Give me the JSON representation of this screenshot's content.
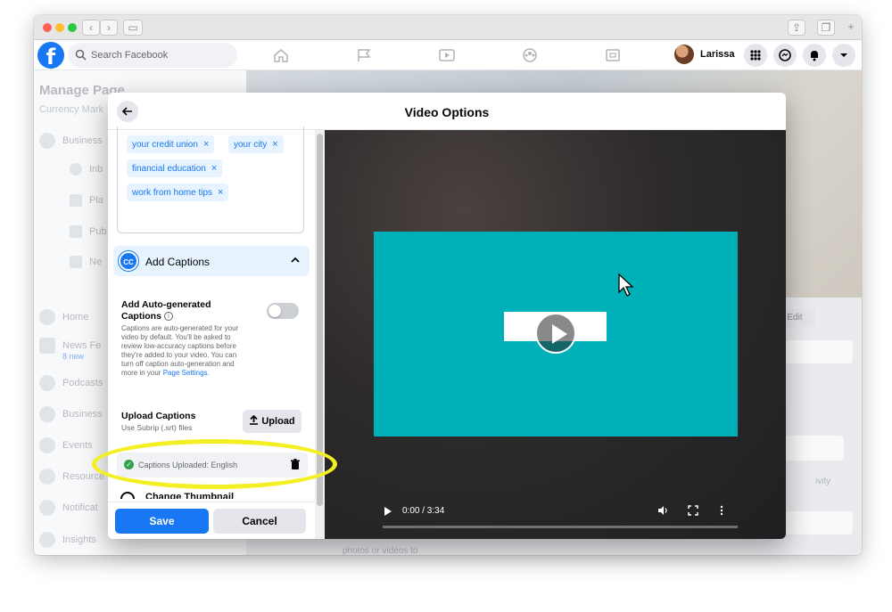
{
  "browser": {
    "traffic_lights": [
      "#ff5f57",
      "#febc2e",
      "#28c840"
    ]
  },
  "topbar": {
    "logo": "f",
    "search_placeholder": "Search Facebook",
    "user_name": "Larissa",
    "nav_icons": [
      "home-icon",
      "flag-icon",
      "watch-icon",
      "groups-icon",
      "gaming-icon"
    ],
    "right_icons": [
      "menu-grid-icon",
      "messenger-icon",
      "notifications-icon",
      "account-dropdown-icon"
    ]
  },
  "background": {
    "page_title": "Manage Page",
    "page_subtitle": "Currency Mark",
    "sidebar_items": [
      "Business",
      "Inb",
      "Pla",
      "Pub",
      "Ne",
      "Home",
      "News Fe",
      "8 new",
      "Podcasts",
      "Business",
      "Events",
      "Resource",
      "Notificat",
      "Insights"
    ],
    "edit_label": "Edit",
    "activity_label": "ivity",
    "bottom_text": "photos or videos to promote your"
  },
  "modal": {
    "title": "Video Options",
    "tags": [
      "your credit union",
      "your city",
      "financial education",
      "work from home tips"
    ],
    "tag_remove": "×",
    "captions": {
      "section_title": "Add Captions",
      "cc_label": "CC",
      "auto_title": "Add Auto-generated Captions",
      "auto_enabled": false,
      "auto_desc": "Captions are auto-generated for your video by default. You'll be asked to review low-accuracy captions before they're added to your video. You can turn off caption auto-generation and more in your",
      "auto_link": "Page Settings",
      "upload_title": "Upload Captions",
      "upload_sub": "Use Subrip (.srt) files",
      "upload_button": "Upload",
      "status_text": "Captions Uploaded: English"
    },
    "next_section": "Change Thumbnail",
    "save_label": "Save",
    "cancel_label": "Cancel"
  },
  "video": {
    "time": "0:00 / 3:34",
    "progress": 0.0,
    "accent": "#00b0b8"
  },
  "colors": {
    "brand": "#1877f2",
    "highlight": "#f4ef22",
    "success": "#31a24c"
  }
}
